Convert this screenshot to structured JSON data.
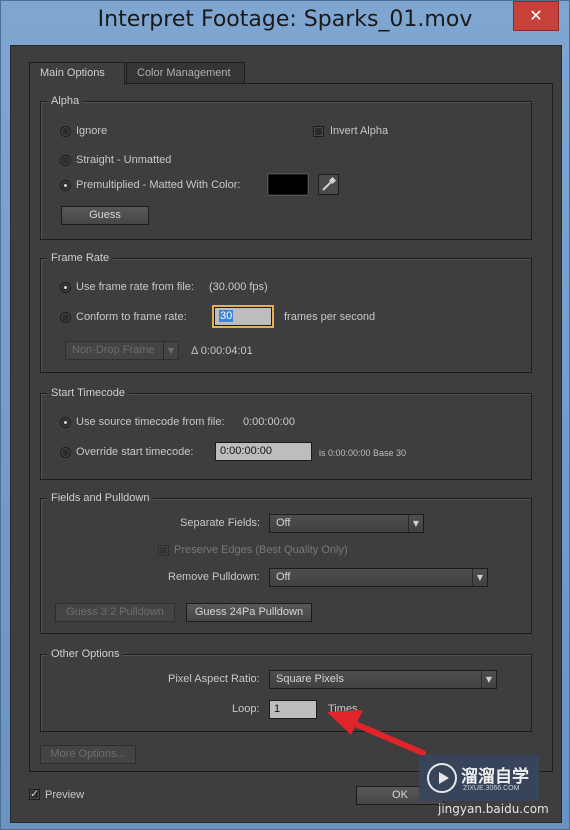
{
  "window": {
    "title": "Interpret Footage: Sparks_01.mov",
    "close_glyph": "✕"
  },
  "tabs": [
    {
      "label": "Main Options",
      "active": true
    },
    {
      "label": "Color Management",
      "active": false
    }
  ],
  "alpha": {
    "label": "Alpha",
    "ignore": "Ignore",
    "invert_alpha": "Invert Alpha",
    "straight": "Straight - Unmatted",
    "premultiplied": "Premultiplied - Matted With Color:",
    "matte_color": "#000000",
    "guess": "Guess"
  },
  "frame_rate": {
    "label": "Frame Rate",
    "use_from_file": "Use frame rate from file:",
    "file_fps": "(30.000 fps)",
    "conform": "Conform to frame rate:",
    "conform_value": "30",
    "fps_suffix": "frames per second",
    "drop_frame": "Non-Drop Frame",
    "duration": "Δ 0:00:04:01"
  },
  "start_timecode": {
    "label": "Start Timecode",
    "use_source": "Use source timecode from file:",
    "source_tc": "0:00:00:00",
    "override": "Override start timecode:",
    "override_value": "0:00:00:00",
    "override_info": "is 0:00:00:00  Base 30"
  },
  "fields": {
    "label": "Fields and Pulldown",
    "separate_label": "Separate Fields:",
    "separate_value": "Off",
    "preserve_edges": "Preserve Edges (Best Quality Only)",
    "remove_pulldown_label": "Remove Pulldown:",
    "remove_pulldown_value": "Off",
    "guess32": "Guess 3:2 Pulldown",
    "guess24": "Guess 24Pa Pulldown"
  },
  "other": {
    "label": "Other Options",
    "par_label": "Pixel Aspect Ratio:",
    "par_value": "Square Pixels",
    "loop_label": "Loop:",
    "loop_value": "1",
    "loop_suffix": "Times"
  },
  "more_options": "More Options...",
  "preview": {
    "label": "Preview",
    "checked": true,
    "glyph": "✓"
  },
  "ok": "OK",
  "watermark": {
    "brand": "溜溜自学",
    "site": "ZIXUE.3066.COM",
    "bottom": "jingyan.baidu.com"
  },
  "colors": {
    "accent_arrow": "#e0242a",
    "panel_bg": "#3e3e3e",
    "titlebar": "#7ea6d1"
  }
}
